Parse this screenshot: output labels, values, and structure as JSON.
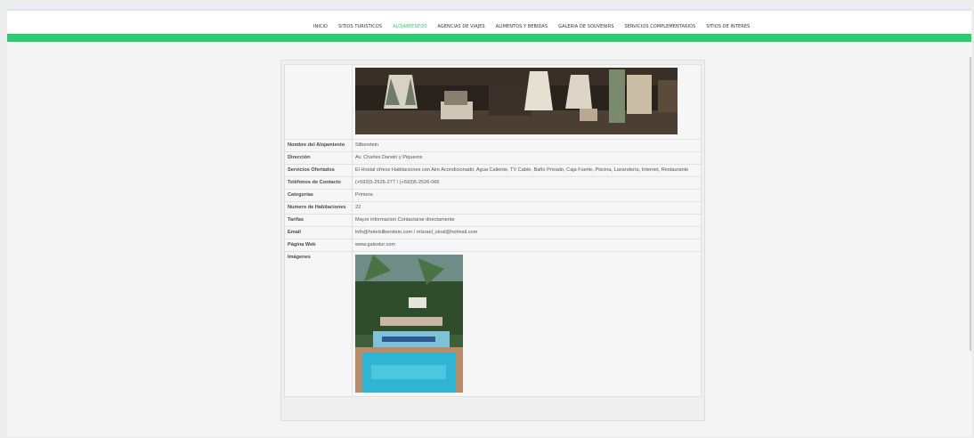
{
  "nav": {
    "items": [
      {
        "label": "INICIO"
      },
      {
        "label": "SITIOS TURISTICOS"
      },
      {
        "label": "ALOJAMIENTOS"
      },
      {
        "label": "AGENCIAS DE VIAJES"
      },
      {
        "label": "ALIMENTOS Y BEBIDAS"
      },
      {
        "label": "GALERIA DE SOUVENIRS"
      },
      {
        "label": "SERVICIOS COMPLEMENTARIOS"
      },
      {
        "label": "SITIOS DE INTERES"
      }
    ],
    "active_index": 2,
    "accent_color": "#2ecc71"
  },
  "details": {
    "rows": [
      {
        "key": "Nombre del Alojamiento",
        "value": "Silberstein"
      },
      {
        "key": "Dirección",
        "value": "Av. Charles Darwin y Piqueros"
      },
      {
        "key": "Servicios Ofertados",
        "value": "El Hostal ofrece Habitaciones con Aire Acondicionado, Agua Caliente, TV Cable, Baño Privado, Caja Fuerte, Piscina, Lavandería, Internet, Restaurante"
      },
      {
        "key": "Teléfonos de Contacto",
        "value": "(+593)5-2526-277 / (+593)5-2526-066"
      },
      {
        "key": "Categorías",
        "value": "Primera"
      },
      {
        "key": "Numero de Habitaciones",
        "value": "22"
      },
      {
        "key": "Tarifas",
        "value": "Mayor informacion Contactarse directamente"
      },
      {
        "key": "Email",
        "value": "info@hotelsilberstein.com / mlsrael_sinal@hotmail.com"
      },
      {
        "key": "Página Web",
        "value": "www.galextur.com"
      }
    ],
    "images_label": "Imágenes"
  }
}
